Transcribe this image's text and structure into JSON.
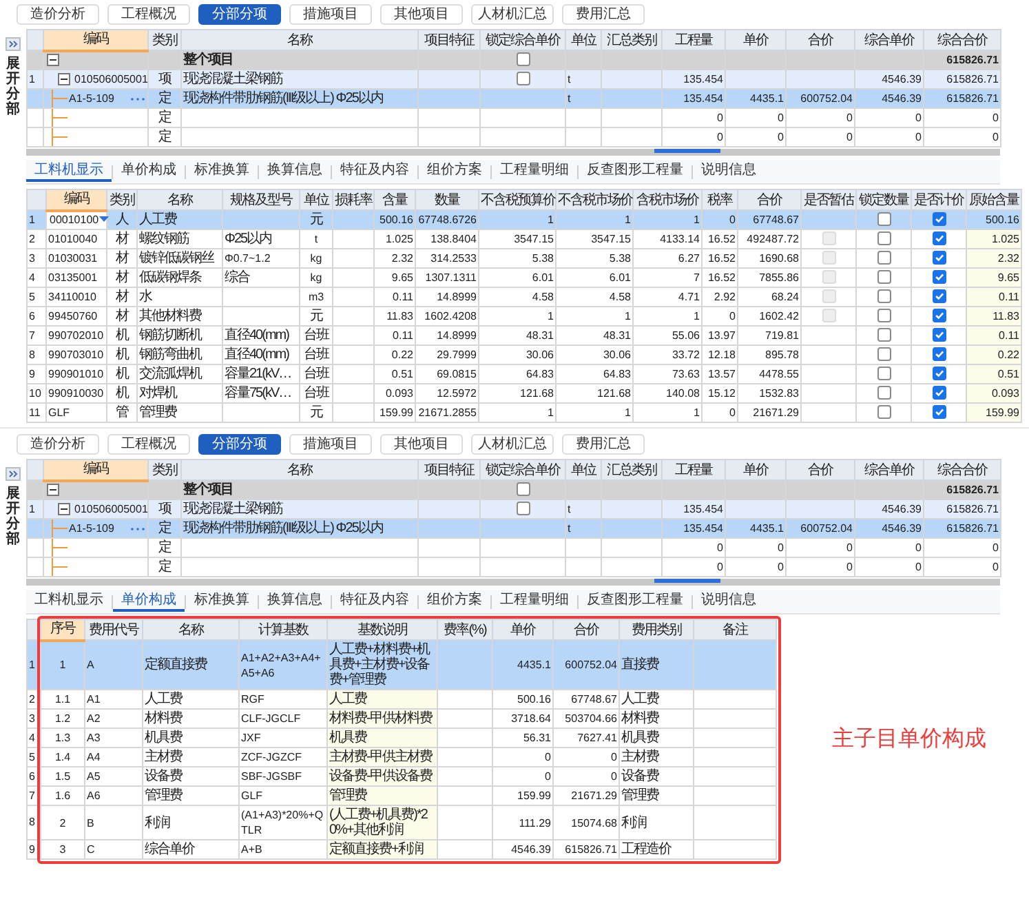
{
  "panels": [
    {
      "toolbar": [
        {
          "label": "造价分析",
          "selected": false
        },
        {
          "label": "工程概况",
          "selected": false
        },
        {
          "label": "分部分项",
          "selected": true
        },
        {
          "label": "措施项目",
          "selected": false
        },
        {
          "label": "其他项目",
          "selected": false
        },
        {
          "label": "人材机汇总",
          "selected": false
        },
        {
          "label": "费用汇总",
          "selected": false
        }
      ],
      "side_label": "展开分部",
      "item_grid": {
        "columns": [
          {
            "label": "编码",
            "selected": true
          },
          {
            "label": "类别",
            "selected": false
          },
          {
            "label": "名称",
            "selected": false
          },
          {
            "label": "项目特征",
            "selected": false
          },
          {
            "label": "锁定综合单价",
            "selected": false
          },
          {
            "label": "单位",
            "selected": false
          },
          {
            "label": "汇总类别",
            "selected": false
          },
          {
            "label": "工程量",
            "selected": false
          },
          {
            "label": "单价",
            "selected": false
          },
          {
            "label": "合价",
            "selected": false
          },
          {
            "label": "综合单价",
            "selected": false
          },
          {
            "label": "综合合价",
            "selected": false
          }
        ],
        "rows": [
          {
            "kind": "group",
            "expanded": true,
            "selected": false,
            "name": "整个项目",
            "locked": false,
            "total": "615826.71",
            "children": [
              {
                "kind": "item",
                "number": "1",
                "expanded": true,
                "selected": false,
                "code": "010506005001",
                "type": "项",
                "name": "现浇混凝土梁钢筋",
                "locked": false,
                "unit": "t",
                "qty": "135.454",
                "cprice": "4546.39",
                "total": "615826.71",
                "children": [
                  {
                    "kind": "quota",
                    "selected": true,
                    "code": "A1-5-109",
                    "type": "定",
                    "name": "现浇构件带肋钢筋(III级以上) Φ25以内",
                    "unit": "t",
                    "qty": "135.454",
                    "price": "4435.1",
                    "sum": "600752.04",
                    "cprice": "4546.39",
                    "total": "615826.71"
                  },
                  {
                    "kind": "quota",
                    "selected": false,
                    "type": "定",
                    "qty": "0",
                    "price": "0",
                    "sum": "0",
                    "cprice": "0",
                    "total": "0"
                  },
                  {
                    "kind": "quota",
                    "selected": false,
                    "type": "定",
                    "qty": "0",
                    "price": "0",
                    "sum": "0",
                    "cprice": "0",
                    "total": "0"
                  }
                ]
              }
            ]
          }
        ]
      },
      "detail_tabs": [
        {
          "label": "工料机显示",
          "selected": true
        },
        {
          "label": "单价构成",
          "selected": false
        },
        {
          "label": "标准换算",
          "selected": false
        },
        {
          "label": "换算信息",
          "selected": false
        },
        {
          "label": "特征及内容",
          "selected": false
        },
        {
          "label": "组价方案",
          "selected": false
        },
        {
          "label": "工程量明细",
          "selected": false
        },
        {
          "label": "反查图形工程量",
          "selected": false
        },
        {
          "label": "说明信息",
          "selected": false
        }
      ],
      "detail_grid": {
        "kind": "resources",
        "columns": [
          {
            "label": "编码",
            "selected": true
          },
          {
            "label": "类别",
            "selected": false
          },
          {
            "label": "名称",
            "selected": false
          },
          {
            "label": "规格及型号",
            "selected": false
          },
          {
            "label": "单位",
            "selected": false
          },
          {
            "label": "损耗率",
            "selected": false
          },
          {
            "label": "含量",
            "selected": false
          },
          {
            "label": "数量",
            "selected": false
          },
          {
            "label": "不含税预算价",
            "selected": false
          },
          {
            "label": "不含税市场价",
            "selected": false
          },
          {
            "label": "含税市场价",
            "selected": false
          },
          {
            "label": "税率",
            "selected": false
          },
          {
            "label": "合价",
            "selected": false
          },
          {
            "label": "是否暂估",
            "selected": false
          },
          {
            "label": "锁定数量",
            "selected": false
          },
          {
            "label": "是否计价",
            "selected": false
          },
          {
            "label": "原始含量",
            "selected": false
          }
        ],
        "rows": [
          {
            "number": "1",
            "selected": true,
            "code": "00010100",
            "type": "人",
            "name": "人工费",
            "unit": "元",
            "content": "500.16",
            "qty": "67748.6726",
            "budget": "1",
            "market": "1",
            "tax_market": "1",
            "tax": "0",
            "sum": "67748.67",
            "lock_qty": false,
            "priced": true,
            "original": "500.16"
          },
          {
            "number": "2",
            "selected": false,
            "code": "01010040",
            "type": "材",
            "name": "螺纹钢筋",
            "spec": "Φ25以内",
            "unit": "t",
            "content": "1.025",
            "qty": "138.8404",
            "budget": "3547.15",
            "market": "3547.15",
            "tax_market": "4133.14",
            "tax": "16.52",
            "sum": "492487.72",
            "estimate": {
              "checked": false,
              "disabled": true
            },
            "lock_qty": false,
            "priced": true,
            "original": "1.025"
          },
          {
            "number": "3",
            "selected": false,
            "code": "01030031",
            "type": "材",
            "name": "镀锌低碳钢丝",
            "spec": "Φ0.7~1.2",
            "unit": "kg",
            "content": "2.32",
            "qty": "314.2533",
            "budget": "5.38",
            "market": "5.38",
            "tax_market": "6.27",
            "tax": "16.52",
            "sum": "1690.68",
            "estimate": {
              "checked": false,
              "disabled": true
            },
            "lock_qty": false,
            "priced": true,
            "original": "2.32"
          },
          {
            "number": "4",
            "selected": false,
            "code": "03135001",
            "type": "材",
            "name": "低碳钢焊条",
            "spec": "综合",
            "unit": "kg",
            "content": "9.65",
            "qty": "1307.1311",
            "budget": "6.01",
            "market": "6.01",
            "tax_market": "7",
            "tax": "16.52",
            "sum": "7855.86",
            "estimate": {
              "checked": false,
              "disabled": true
            },
            "lock_qty": false,
            "priced": true,
            "original": "9.65"
          },
          {
            "number": "5",
            "selected": false,
            "code": "34110010",
            "type": "材",
            "name": "水",
            "unit": "m3",
            "content": "0.11",
            "qty": "14.8999",
            "budget": "4.58",
            "market": "4.58",
            "tax_market": "4.71",
            "tax": "2.92",
            "sum": "68.24",
            "estimate": {
              "checked": false,
              "disabled": true
            },
            "lock_qty": false,
            "priced": true,
            "original": "0.11"
          },
          {
            "number": "6",
            "selected": false,
            "code": "99450760",
            "type": "材",
            "name": "其他材料费",
            "unit": "元",
            "content": "11.83",
            "qty": "1602.4208",
            "budget": "1",
            "market": "1",
            "tax_market": "1",
            "tax": "0",
            "sum": "1602.42",
            "estimate": {
              "checked": false,
              "disabled": true
            },
            "lock_qty": false,
            "priced": true,
            "original": "11.83"
          },
          {
            "number": "7",
            "selected": false,
            "code": "990702010",
            "type": "机",
            "name": "钢筋切断机",
            "spec": "直径40(mm)",
            "unit": "台班",
            "content": "0.11",
            "qty": "14.8999",
            "budget": "48.31",
            "market": "48.31",
            "tax_market": "55.06",
            "tax": "13.97",
            "sum": "719.81",
            "lock_qty": false,
            "priced": true,
            "original": "0.11"
          },
          {
            "number": "8",
            "selected": false,
            "code": "990703010",
            "type": "机",
            "name": "钢筋弯曲机",
            "spec": "直径40(mm)",
            "unit": "台班",
            "content": "0.22",
            "qty": "29.7999",
            "budget": "30.06",
            "market": "30.06",
            "tax_market": "33.72",
            "tax": "12.18",
            "sum": "895.78",
            "lock_qty": false,
            "priced": true,
            "original": "0.22"
          },
          {
            "number": "9",
            "selected": false,
            "code": "990901010",
            "type": "机",
            "name": "交流弧焊机",
            "spec": "容量21(kV…",
            "unit": "台班",
            "content": "0.51",
            "qty": "69.0815",
            "budget": "64.83",
            "market": "64.83",
            "tax_market": "73.63",
            "tax": "13.57",
            "sum": "4478.55",
            "lock_qty": false,
            "priced": true,
            "original": "0.51"
          },
          {
            "number": "10",
            "selected": false,
            "code": "990910030",
            "type": "机",
            "name": "对焊机",
            "spec": "容量75(kV…",
            "unit": "台班",
            "content": "0.093",
            "qty": "12.5972",
            "budget": "121.68",
            "market": "121.68",
            "tax_market": "140.08",
            "tax": "15.12",
            "sum": "1532.83",
            "lock_qty": false,
            "priced": true,
            "original": "0.093"
          },
          {
            "number": "11",
            "selected": false,
            "code": "GLF",
            "type": "管",
            "name": "管理费",
            "unit": "元",
            "content": "159.99",
            "qty": "21671.2855",
            "budget": "1",
            "market": "1",
            "tax_market": "1",
            "tax": "0",
            "sum": "21671.29",
            "lock_qty": false,
            "priced": true,
            "original": "159.99"
          }
        ]
      }
    },
    {
      "toolbar": [
        {
          "label": "造价分析",
          "selected": false
        },
        {
          "label": "工程概况",
          "selected": false
        },
        {
          "label": "分部分项",
          "selected": true
        },
        {
          "label": "措施项目",
          "selected": false
        },
        {
          "label": "其他项目",
          "selected": false
        },
        {
          "label": "人材机汇总",
          "selected": false
        },
        {
          "label": "费用汇总",
          "selected": false
        }
      ],
      "side_label": "展开分部",
      "item_grid": {
        "columns": [
          {
            "label": "编码",
            "selected": true
          },
          {
            "label": "类别",
            "selected": false
          },
          {
            "label": "名称",
            "selected": false
          },
          {
            "label": "项目特征",
            "selected": false
          },
          {
            "label": "锁定综合单价",
            "selected": false
          },
          {
            "label": "单位",
            "selected": false
          },
          {
            "label": "汇总类别",
            "selected": false
          },
          {
            "label": "工程量",
            "selected": false
          },
          {
            "label": "单价",
            "selected": false
          },
          {
            "label": "合价",
            "selected": false
          },
          {
            "label": "综合单价",
            "selected": false
          },
          {
            "label": "综合合价",
            "selected": false
          }
        ],
        "rows": [
          {
            "kind": "group",
            "expanded": true,
            "selected": false,
            "name": "整个项目",
            "locked": false,
            "total": "615826.71",
            "children": [
              {
                "kind": "item",
                "number": "1",
                "expanded": true,
                "selected": false,
                "code": "010506005001",
                "type": "项",
                "name": "现浇混凝土梁钢筋",
                "locked": false,
                "unit": "t",
                "qty": "135.454",
                "cprice": "4546.39",
                "total": "615826.71",
                "children": [
                  {
                    "kind": "quota",
                    "selected": true,
                    "code": "A1-5-109",
                    "type": "定",
                    "name": "现浇构件带肋钢筋(III级以上) Φ25以内",
                    "unit": "t",
                    "qty": "135.454",
                    "price": "4435.1",
                    "sum": "600752.04",
                    "cprice": "4546.39",
                    "total": "615826.71"
                  },
                  {
                    "kind": "quota",
                    "selected": false,
                    "type": "定",
                    "qty": "0",
                    "price": "0",
                    "sum": "0",
                    "cprice": "0",
                    "total": "0"
                  },
                  {
                    "kind": "quota",
                    "selected": false,
                    "type": "定",
                    "qty": "0",
                    "price": "0",
                    "sum": "0",
                    "cprice": "0",
                    "total": "0"
                  }
                ]
              }
            ]
          }
        ]
      },
      "detail_tabs": [
        {
          "label": "工料机显示",
          "selected": false
        },
        {
          "label": "单价构成",
          "selected": true
        },
        {
          "label": "标准换算",
          "selected": false
        },
        {
          "label": "换算信息",
          "selected": false
        },
        {
          "label": "特征及内容",
          "selected": false
        },
        {
          "label": "组价方案",
          "selected": false
        },
        {
          "label": "工程量明细",
          "selected": false
        },
        {
          "label": "反查图形工程量",
          "selected": false
        },
        {
          "label": "说明信息",
          "selected": false
        }
      ],
      "detail_grid": {
        "kind": "cost_breakdown",
        "highlighted": true,
        "columns": [
          {
            "label": "序号",
            "selected": true
          },
          {
            "label": "费用代号",
            "selected": false
          },
          {
            "label": "名称",
            "selected": false
          },
          {
            "label": "计算基数",
            "selected": false
          },
          {
            "label": "基数说明",
            "selected": false
          },
          {
            "label": "费率(%)",
            "selected": false
          },
          {
            "label": "单价",
            "selected": false
          },
          {
            "label": "合价",
            "selected": false
          },
          {
            "label": "费用类别",
            "selected": false
          },
          {
            "label": "备注",
            "selected": false
          }
        ],
        "rows": [
          {
            "number": "1",
            "selected": true,
            "seq": "1",
            "code": "A",
            "name": "定额直接费",
            "base": "A1+A2+A3+A4+A5+A6",
            "base_desc": "人工费+材料费+机具费+主材费+设备费+管理费",
            "price": "4435.1",
            "sum": "600752.04",
            "category": "直接费"
          },
          {
            "number": "2",
            "selected": false,
            "seq": "1.1",
            "code": "A1",
            "name": "人工费",
            "base": "RGF",
            "base_desc": "人工费",
            "price": "500.16",
            "sum": "67748.67",
            "category": "人工费"
          },
          {
            "number": "3",
            "selected": false,
            "seq": "1.2",
            "code": "A2",
            "name": "材料费",
            "base": "CLF-JGCLF",
            "base_desc": "材料费-甲供材料费",
            "price": "3718.64",
            "sum": "503704.66",
            "category": "材料费"
          },
          {
            "number": "4",
            "selected": false,
            "seq": "1.3",
            "code": "A3",
            "name": "机具费",
            "base": "JXF",
            "base_desc": "机具费",
            "price": "56.31",
            "sum": "7627.41",
            "category": "机具费"
          },
          {
            "number": "5",
            "selected": false,
            "seq": "1.4",
            "code": "A4",
            "name": "主材费",
            "base": "ZCF-JGZCF",
            "base_desc": "主材费-甲供主材费",
            "price": "0",
            "sum": "0",
            "category": "主材费"
          },
          {
            "number": "6",
            "selected": false,
            "seq": "1.5",
            "code": "A5",
            "name": "设备费",
            "base": "SBF-JGSBF",
            "base_desc": "设备费-甲供设备费",
            "price": "0",
            "sum": "0",
            "category": "设备费"
          },
          {
            "number": "7",
            "selected": false,
            "seq": "1.6",
            "code": "A6",
            "name": "管理费",
            "base": "GLF",
            "base_desc": "管理费",
            "price": "159.99",
            "sum": "21671.29",
            "category": "管理费"
          },
          {
            "number": "8",
            "selected": false,
            "seq": "2",
            "code": "B",
            "name": "利润",
            "base": "(A1+A3)*20%+QTLR",
            "base_desc": "(人工费+机具费)*20%+其他利润",
            "price": "111.29",
            "sum": "15074.68",
            "category": "利润"
          },
          {
            "number": "9",
            "selected": false,
            "seq": "3",
            "code": "C",
            "name": "综合单价",
            "base": "A+B",
            "base_desc": "定额直接费+利润",
            "price": "4546.39",
            "sum": "615826.71",
            "category": "工程造价"
          }
        ]
      }
    }
  ],
  "annotation": "主子目单价构成"
}
